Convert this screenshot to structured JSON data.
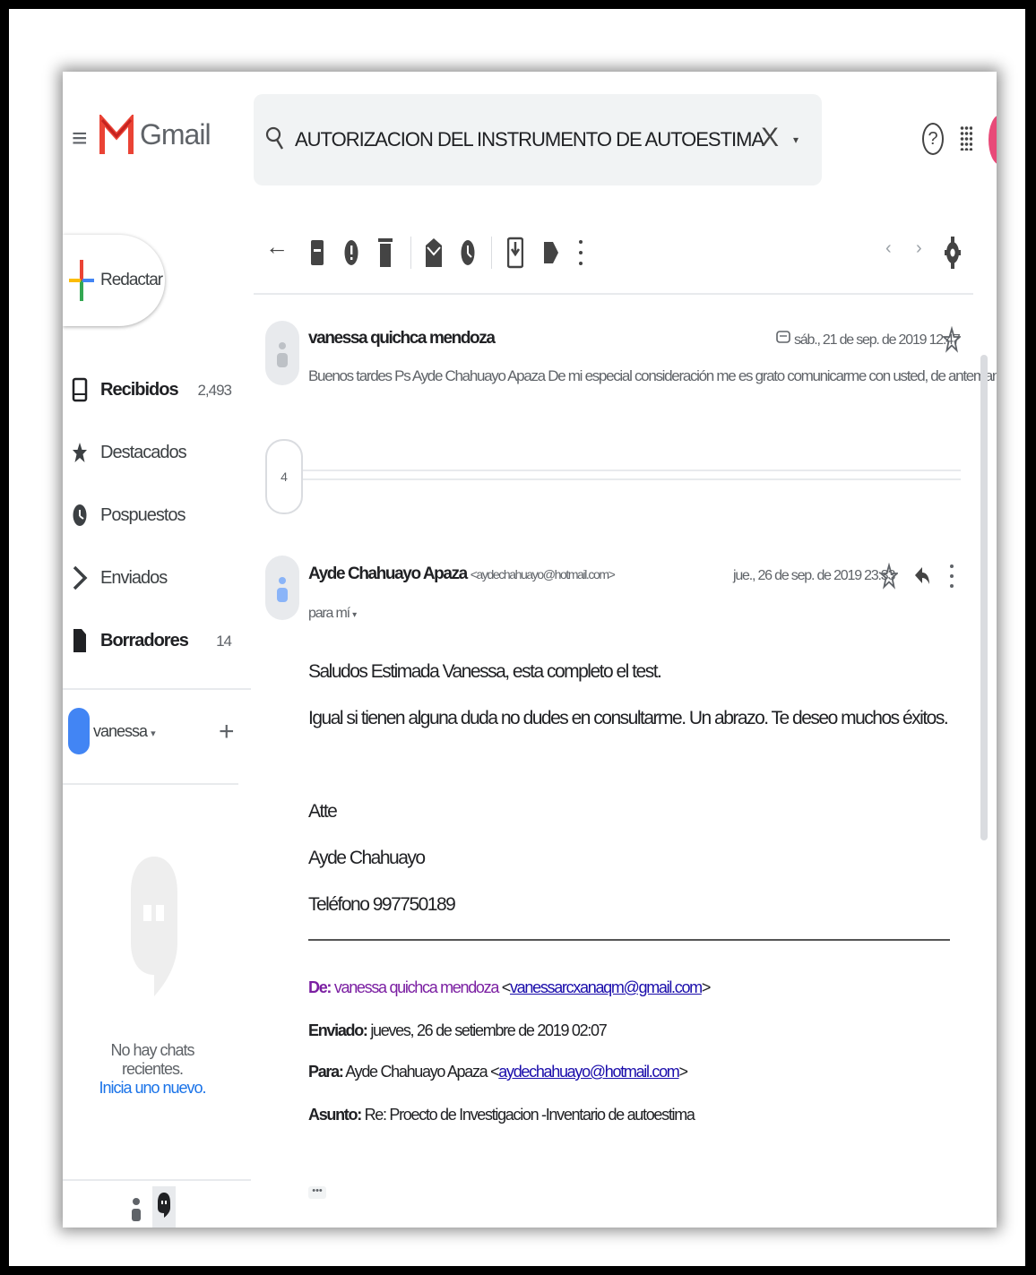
{
  "app": {
    "name": "Gmail"
  },
  "search": {
    "query": "AUTORIZACION DEL INSTRUMENTO DE AUTOESTIMA",
    "clear": "X",
    "dropdown": "▾"
  },
  "header": {
    "help": "?"
  },
  "compose": {
    "label": "Redactar"
  },
  "nav": [
    {
      "label": "Recibidos",
      "count": "2,493",
      "bold": true,
      "icon": "inbox-icon"
    },
    {
      "label": "Destacados",
      "count": "",
      "bold": false,
      "icon": "star-icon"
    },
    {
      "label": "Pospuestos",
      "count": "",
      "bold": false,
      "icon": "clock-icon"
    },
    {
      "label": "Enviados",
      "count": "",
      "bold": false,
      "icon": "send-icon"
    },
    {
      "label": "Borradores",
      "count": "14",
      "bold": true,
      "icon": "draft-icon"
    }
  ],
  "hangouts": {
    "user": "vanessa",
    "user_caret": "▾",
    "add": "+",
    "no_chats": "No hay chats recientes.",
    "new_chat": "Inicia uno nuevo."
  },
  "toolbar": {
    "back": "←",
    "prev": "‹",
    "next": "›"
  },
  "thread": {
    "collapsed_count": "4",
    "message1": {
      "sender": "vanessa quichca mendoza",
      "date": "sáb., 21 de sep. de 2019 12:47",
      "snippet": "Buenos tardes Ps Ayde Chahuayo Apaza De mi especial consideración me es grato comunicarme con usted, de antemano gracias por s..."
    },
    "message2": {
      "sender": "Ayde Chahuayo Apaza",
      "email": "<aydechahuayo@hotmail.com>",
      "date": "jue., 26 de sep. de 2019 23:33",
      "to": "para mí",
      "to_caret": "▾",
      "body": [
        "Saludos Estimada Vanessa, esta completo el test.",
        "Igual si tienen  alguna duda  no dudes en consultarme. Un abrazo. Te deseo muchos éxitos.",
        "Atte",
        " Ayde Chahuayo",
        "Teléfono 997750189"
      ],
      "forwarded": {
        "from_label": "De:",
        "from_name": "vanessa quichca mendoza",
        "from_email": "vanessarcxanaqm@gmail.com",
        "sent_label": "Enviado:",
        "sent_value": "jueves, 26 de setiembre de 2019 02:07",
        "to_label": "Para:",
        "to_name": "Ayde Chahuayo Apaza",
        "to_email": "aydechahuayo@hotmail.com",
        "subject_label": "Asunto:",
        "subject_value": "Re: Proecto de Investigacion -Inventario de autoestima"
      },
      "more": "•••"
    }
  },
  "colors": {
    "accent_red": "#ea4335",
    "link": "#1a73e8",
    "from_label": "#7b1fa2"
  }
}
